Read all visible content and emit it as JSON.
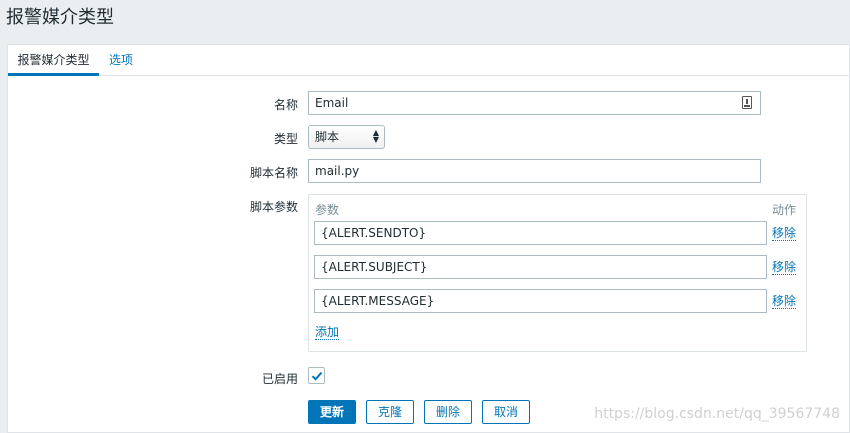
{
  "page": {
    "title": "报警媒介类型"
  },
  "tabs": [
    {
      "label": "报警媒介类型"
    },
    {
      "label": "选项"
    }
  ],
  "form": {
    "name_label": "名称",
    "name_value": "Email",
    "type_label": "类型",
    "type_value": "脚本",
    "script_name_label": "脚本名称",
    "script_name_value": "mail.py",
    "script_params_label": "脚本参数",
    "params_header": "参数",
    "action_header": "动作",
    "params": [
      {
        "value": "{ALERT.SENDTO}",
        "remove_label": "移除"
      },
      {
        "value": "{ALERT.SUBJECT}",
        "remove_label": "移除"
      },
      {
        "value": "{ALERT.MESSAGE}",
        "remove_label": "移除"
      }
    ],
    "add_label": "添加",
    "enabled_label": "已启用",
    "enabled_checked": true
  },
  "buttons": {
    "update": "更新",
    "clone": "克隆",
    "delete": "删除",
    "cancel": "取消"
  },
  "watermark": "https://blog.csdn.net/qq_39567748",
  "colors": {
    "accent": "#0275b8",
    "background": "#ebeef0"
  },
  "icons": {
    "name_field": "text-icon",
    "select": "chevron-updown-icon",
    "checkbox": "checkmark-icon"
  }
}
